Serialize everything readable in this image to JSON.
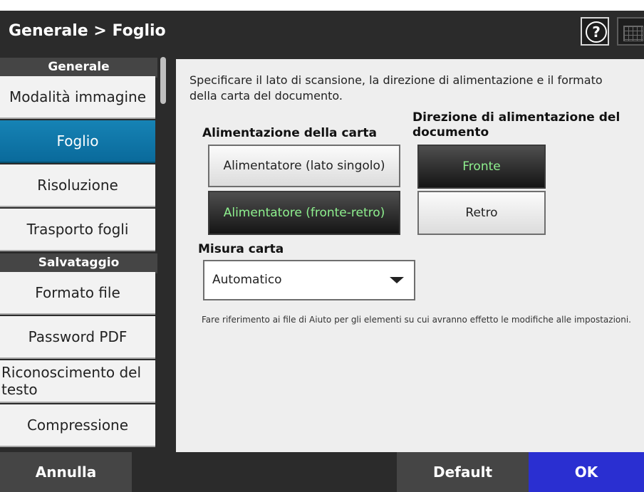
{
  "header": {
    "title": "Generale > Foglio",
    "help_icon": "help-icon",
    "help_glyph": "?",
    "keyboard_icon": "keyboard-icon"
  },
  "sidebar": {
    "sections": [
      {
        "label": "Generale"
      },
      {
        "label": "Salvataggio"
      }
    ],
    "items": [
      {
        "label": "Modalità immagine"
      },
      {
        "label": "Foglio",
        "active": true
      },
      {
        "label": "Risoluzione"
      },
      {
        "label": "Trasporto fogli"
      },
      {
        "label": "Formato file"
      },
      {
        "label": "Password PDF"
      },
      {
        "label": "Riconoscimento del testo"
      },
      {
        "label": "Compressione"
      }
    ]
  },
  "main": {
    "description": "Specificare il lato di scansione, la direzione di alimentazione e il formato della carta del documento.",
    "feed": {
      "label": "Alimentazione della carta",
      "options": [
        {
          "label": "Alimentatore (lato singolo)",
          "selected": false
        },
        {
          "label": "Alimentatore (fronte-retro)",
          "selected": true
        }
      ]
    },
    "direction": {
      "label": "Direzione di alimentazione del documento",
      "options": [
        {
          "label": "Fronte",
          "selected": true
        },
        {
          "label": "Retro",
          "selected": false
        }
      ]
    },
    "paper_size": {
      "label": "Misura carta",
      "value": "Automatico"
    },
    "note": "Fare riferimento ai file di Aiuto per gli elementi su cui avranno effetto le modifiche alle impostazioni."
  },
  "footer": {
    "cancel": "Annulla",
    "default": "Default",
    "ok": "OK"
  },
  "colors": {
    "active_item": "#0e76a8",
    "ok_button": "#2a2fd1",
    "default_button": "#454545",
    "selected_text": "#8ef08e"
  }
}
